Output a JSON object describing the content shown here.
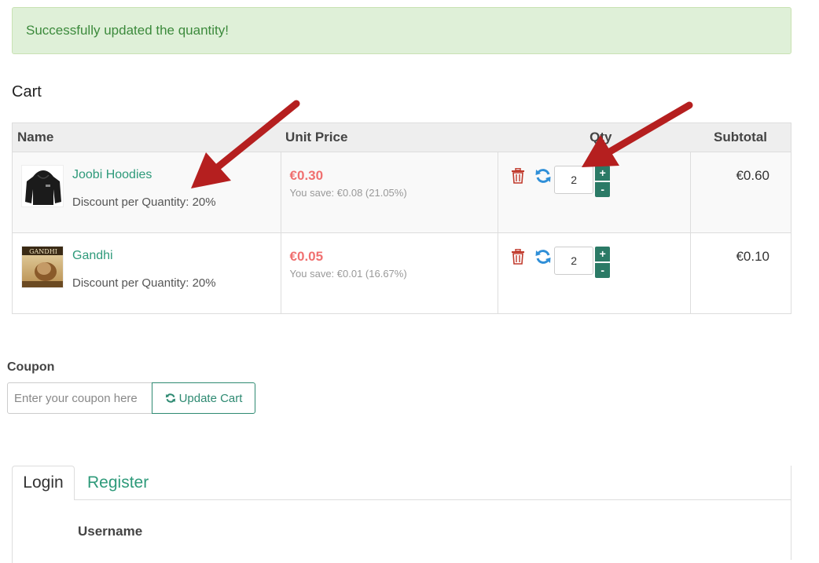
{
  "alert": {
    "message": "Successfully updated the quantity!"
  },
  "cart": {
    "title": "Cart",
    "headers": {
      "name": "Name",
      "unit_price": "Unit Price",
      "qty": "Qty",
      "subtotal": "Subtotal"
    },
    "items": [
      {
        "name": "Joobi Hoodies",
        "discount": "Discount per Quantity: 20%",
        "price": "€0.30",
        "savings": "You save: €0.08 (21.05%)",
        "qty": "2",
        "plus": "+",
        "minus": "-",
        "subtotal": "€0.60"
      },
      {
        "name": "Gandhi",
        "discount": "Discount per Quantity: 20%",
        "price": "€0.05",
        "savings": "You save: €0.01 (16.67%)",
        "qty": "2",
        "plus": "+",
        "minus": "-",
        "subtotal": "€0.10"
      }
    ],
    "gandhi_cover_text": "GANDHI"
  },
  "coupon": {
    "label": "Coupon",
    "placeholder": "Enter your coupon here",
    "update_label": "Update Cart"
  },
  "tabs": {
    "login": "Login",
    "register": "Register",
    "username_label": "Username"
  },
  "colors": {
    "accent": "#2e9a7a",
    "price": "#f07070",
    "alert_bg": "#dff0d8",
    "arrow": "#b51f1f"
  }
}
